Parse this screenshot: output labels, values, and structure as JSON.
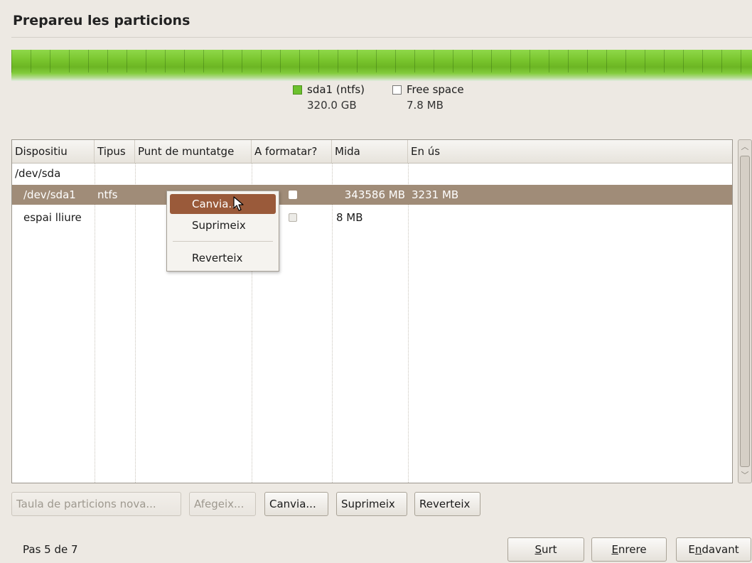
{
  "page": {
    "title": "Prepareu les particions"
  },
  "colors": {
    "partition_green": "#6cb524",
    "selection": "#a08c78",
    "menu_active": "#9a5a3a"
  },
  "legend": [
    {
      "name": "sda1 (ntfs)",
      "size": "320.0 GB",
      "swatch": "#6cc12e"
    },
    {
      "name": "Free space",
      "size": "7.8 MB",
      "swatch": "#ffffff"
    }
  ],
  "usage_bar": {
    "sda1_fraction": 1.0
  },
  "table": {
    "headers": {
      "device": "Dispositiu",
      "type": "Tipus",
      "mount": "Punt de muntatge",
      "format": "A formatar?",
      "size": "Mida",
      "used": "En ús"
    },
    "rows": [
      {
        "device": "/dev/sda",
        "type": "",
        "mount": "",
        "size": "",
        "used": ""
      },
      {
        "device": "/dev/sda1",
        "type": "ntfs",
        "mount": "",
        "size": "343586 MB",
        "used": "3231 MB",
        "selected": true,
        "format_checked": false
      },
      {
        "device": "espai lliure",
        "type": "",
        "mount": "",
        "size": "8 MB",
        "used": "",
        "format_checked": false
      }
    ]
  },
  "context_menu": {
    "change": "Canvia...",
    "delete": "Suprimeix",
    "revert": "Reverteix"
  },
  "actions": {
    "new_table": "Taula de particions nova...",
    "add": "Afegeix...",
    "change": "Canvia...",
    "delete": "Suprimeix",
    "revert": "Reverteix"
  },
  "footer": {
    "step": "Pas 5 de 7",
    "quit_mnemonic": "S",
    "quit_rest": "urt",
    "back_mnemonic": "E",
    "back_rest": "nrere",
    "fwd_prefix": "E",
    "fwd_mnemonic": "n",
    "fwd_rest": "davant"
  }
}
